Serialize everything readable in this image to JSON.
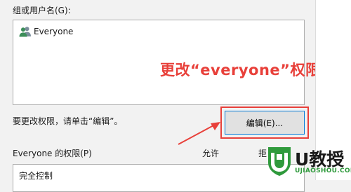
{
  "dialog": {
    "groups_label": "组或用户名(G):",
    "groups": [
      {
        "name": "Everyone",
        "icon": "users-icon"
      }
    ],
    "change_hint": "要更改权限，请单击“编辑”。",
    "edit_button_label": "编辑(E)...",
    "permissions_label": "Everyone 的权限(P)",
    "allow_header": "允许",
    "deny_header": "拒",
    "permissions": [
      {
        "name": "完全控制"
      }
    ]
  },
  "annotation": {
    "text": "更改“everyone”权限",
    "color": "#e8403a"
  },
  "watermark": {
    "title": "U教授",
    "domain": "UJIAOSHOU.COM",
    "icon": "ujiaoshou-shield-logo",
    "brand_color": "#2f9a3c"
  },
  "colors": {
    "dialog_bg": "#f2f2f2",
    "list_bg": "#ffffff",
    "button_border": "#0078d7",
    "highlight": "#e8403a"
  }
}
